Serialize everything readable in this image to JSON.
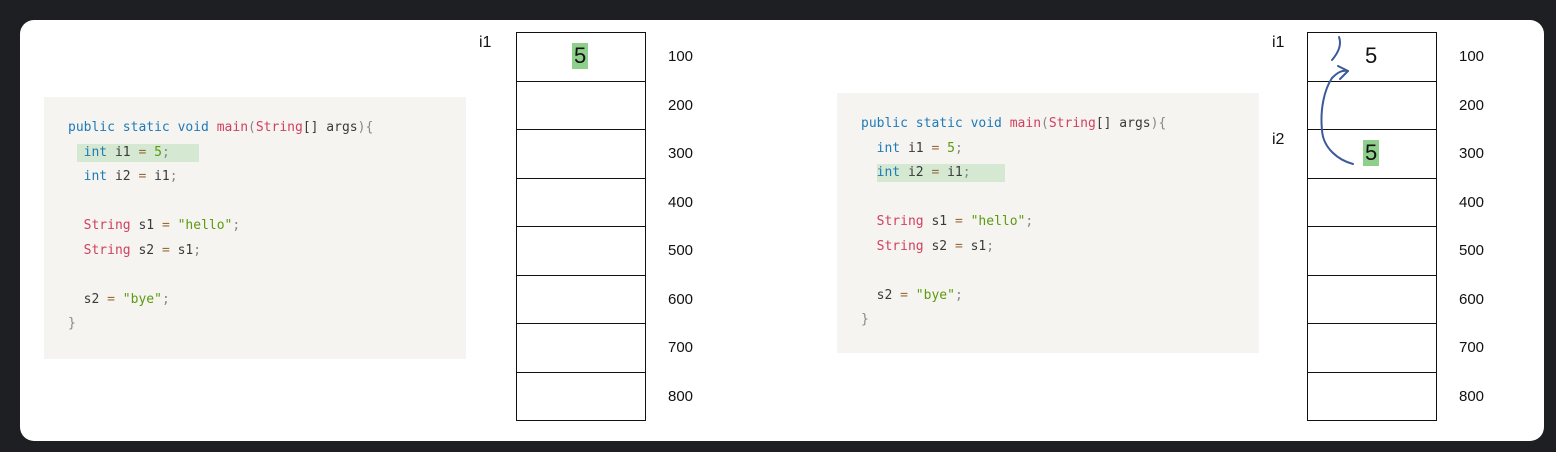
{
  "left_panel": {
    "code": {
      "highlight_line": 1,
      "lines": [
        [
          {
            "t": "public static void ",
            "c": "kw"
          },
          {
            "t": "main",
            "c": "fn"
          },
          {
            "t": "(",
            "c": "pun"
          },
          {
            "t": "String",
            "c": "ty"
          },
          {
            "t": "[] args",
            "c": "id"
          },
          {
            "t": "){",
            "c": "pun"
          }
        ],
        [
          {
            "t": "  int ",
            "c": "kw"
          },
          {
            "t": "i1 ",
            "c": "id"
          },
          {
            "t": "= ",
            "c": "op"
          },
          {
            "t": "5",
            "c": "str"
          },
          {
            "t": ";",
            "c": "pun"
          }
        ],
        [
          {
            "t": "  int ",
            "c": "kw"
          },
          {
            "t": "i2 ",
            "c": "id"
          },
          {
            "t": "= ",
            "c": "op"
          },
          {
            "t": "i1",
            "c": "id"
          },
          {
            "t": ";",
            "c": "pun"
          }
        ],
        [],
        [
          {
            "t": "  String ",
            "c": "ty"
          },
          {
            "t": "s1 ",
            "c": "id"
          },
          {
            "t": "= ",
            "c": "op"
          },
          {
            "t": "\"hello\"",
            "c": "str"
          },
          {
            "t": ";",
            "c": "pun"
          }
        ],
        [
          {
            "t": "  String ",
            "c": "ty"
          },
          {
            "t": "s2 ",
            "c": "id"
          },
          {
            "t": "= ",
            "c": "op"
          },
          {
            "t": "s1",
            "c": "id"
          },
          {
            "t": ";",
            "c": "pun"
          }
        ],
        [],
        [
          {
            "t": "  s2 ",
            "c": "id"
          },
          {
            "t": "= ",
            "c": "op"
          },
          {
            "t": "\"bye\"",
            "c": "str"
          },
          {
            "t": ";",
            "c": "pun"
          }
        ],
        [
          {
            "t": "}",
            "c": "pun"
          }
        ]
      ]
    },
    "memory": {
      "addresses": [
        "100",
        "200",
        "300",
        "400",
        "500",
        "600",
        "700",
        "800"
      ],
      "values": [
        "5",
        "",
        "",
        "",
        "",
        "",
        "",
        ""
      ],
      "highlighted_values": [
        0
      ],
      "labels": [
        {
          "text": "i1",
          "row": 0
        }
      ]
    }
  },
  "right_panel": {
    "code": {
      "highlight_line": 2,
      "lines": [
        [
          {
            "t": "public static void ",
            "c": "kw"
          },
          {
            "t": "main",
            "c": "fn"
          },
          {
            "t": "(",
            "c": "pun"
          },
          {
            "t": "String",
            "c": "ty"
          },
          {
            "t": "[] args",
            "c": "id"
          },
          {
            "t": "){",
            "c": "pun"
          }
        ],
        [
          {
            "t": "  int ",
            "c": "kw"
          },
          {
            "t": "i1 ",
            "c": "id"
          },
          {
            "t": "= ",
            "c": "op"
          },
          {
            "t": "5",
            "c": "str"
          },
          {
            "t": ";",
            "c": "pun"
          }
        ],
        [
          {
            "t": "  int ",
            "c": "kw"
          },
          {
            "t": "i2 ",
            "c": "id"
          },
          {
            "t": "= ",
            "c": "op"
          },
          {
            "t": "i1",
            "c": "id"
          },
          {
            "t": ";",
            "c": "pun"
          }
        ],
        [],
        [
          {
            "t": "  String ",
            "c": "ty"
          },
          {
            "t": "s1 ",
            "c": "id"
          },
          {
            "t": "= ",
            "c": "op"
          },
          {
            "t": "\"hello\"",
            "c": "str"
          },
          {
            "t": ";",
            "c": "pun"
          }
        ],
        [
          {
            "t": "  String ",
            "c": "ty"
          },
          {
            "t": "s2 ",
            "c": "id"
          },
          {
            "t": "= ",
            "c": "op"
          },
          {
            "t": "s1",
            "c": "id"
          },
          {
            "t": ";",
            "c": "pun"
          }
        ],
        [],
        [
          {
            "t": "  s2 ",
            "c": "id"
          },
          {
            "t": "= ",
            "c": "op"
          },
          {
            "t": "\"bye\"",
            "c": "str"
          },
          {
            "t": ";",
            "c": "pun"
          }
        ],
        [
          {
            "t": "}",
            "c": "pun"
          }
        ]
      ]
    },
    "memory": {
      "addresses": [
        "100",
        "200",
        "300",
        "400",
        "500",
        "600",
        "700",
        "800"
      ],
      "values": [
        "5",
        "",
        "5",
        "",
        "",
        "",
        "",
        ""
      ],
      "highlighted_values": [
        2
      ],
      "labels": [
        {
          "text": "i1",
          "row": 0
        },
        {
          "text": "i2",
          "row": 2
        }
      ]
    }
  },
  "colors": {
    "background": "#1e1f22",
    "card": "#ffffff",
    "code_bg": "#f5f4f1",
    "highlight": "#d4e8d2",
    "value_highlight": "#8fcf8c",
    "arrow": "#3a5a9a"
  }
}
